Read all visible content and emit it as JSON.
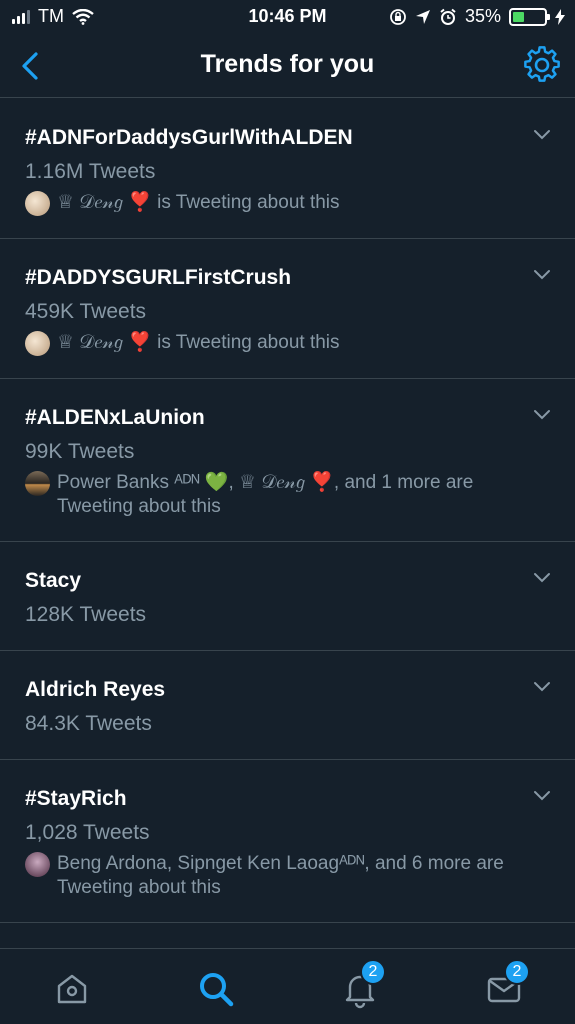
{
  "status_bar": {
    "carrier": "TM",
    "time": "10:46 PM",
    "battery_percent": "35%",
    "battery_level": 0.35,
    "icons": [
      "signal-icon",
      "wifi-icon",
      "orientation-lock-icon",
      "location-icon",
      "alarm-icon",
      "battery-icon",
      "charging-icon"
    ]
  },
  "nav": {
    "title": "Trends for you",
    "back_icon": "chevron-left-icon",
    "settings_icon": "gear-icon"
  },
  "trends": [
    {
      "name": "#ADNForDaddysGurlWithALDEN",
      "count": "1.16M Tweets",
      "context": "♕ 𝒟𝑒𝓃𝑔 ❣️ is Tweeting about this"
    },
    {
      "name": "#DADDYSGURLFirstCrush",
      "count": "459K Tweets",
      "context": "♕ 𝒟𝑒𝓃𝑔 ❣️ is Tweeting about this"
    },
    {
      "name": "#ALDENxLaUnion",
      "count": "99K Tweets",
      "context": "Power Banks ᴬᴰᴺ 💚, ♕ 𝒟𝑒𝓃𝑔 ❣️, and 1 more are Tweeting about this"
    },
    {
      "name": "Stacy",
      "count": "128K Tweets",
      "context": ""
    },
    {
      "name": "Aldrich Reyes",
      "count": "84.3K Tweets",
      "context": ""
    },
    {
      "name": "#StayRich",
      "count": "1,028 Tweets",
      "context": "Beng Ardona, Sipnget Ken Laoagᴬᴰᴺ, and 6 more are Tweeting about this"
    }
  ],
  "tabbar": {
    "tabs": [
      {
        "name": "home",
        "icon": "home-icon"
      },
      {
        "name": "search",
        "icon": "search-icon",
        "active": true
      },
      {
        "name": "notifications",
        "icon": "bell-icon",
        "badge": "2"
      },
      {
        "name": "messages",
        "icon": "envelope-icon",
        "badge": "2"
      }
    ]
  },
  "colors": {
    "background": "#15202b",
    "accent": "#1da1f2",
    "secondary_text": "#8899a6",
    "divider": "#38444d"
  }
}
